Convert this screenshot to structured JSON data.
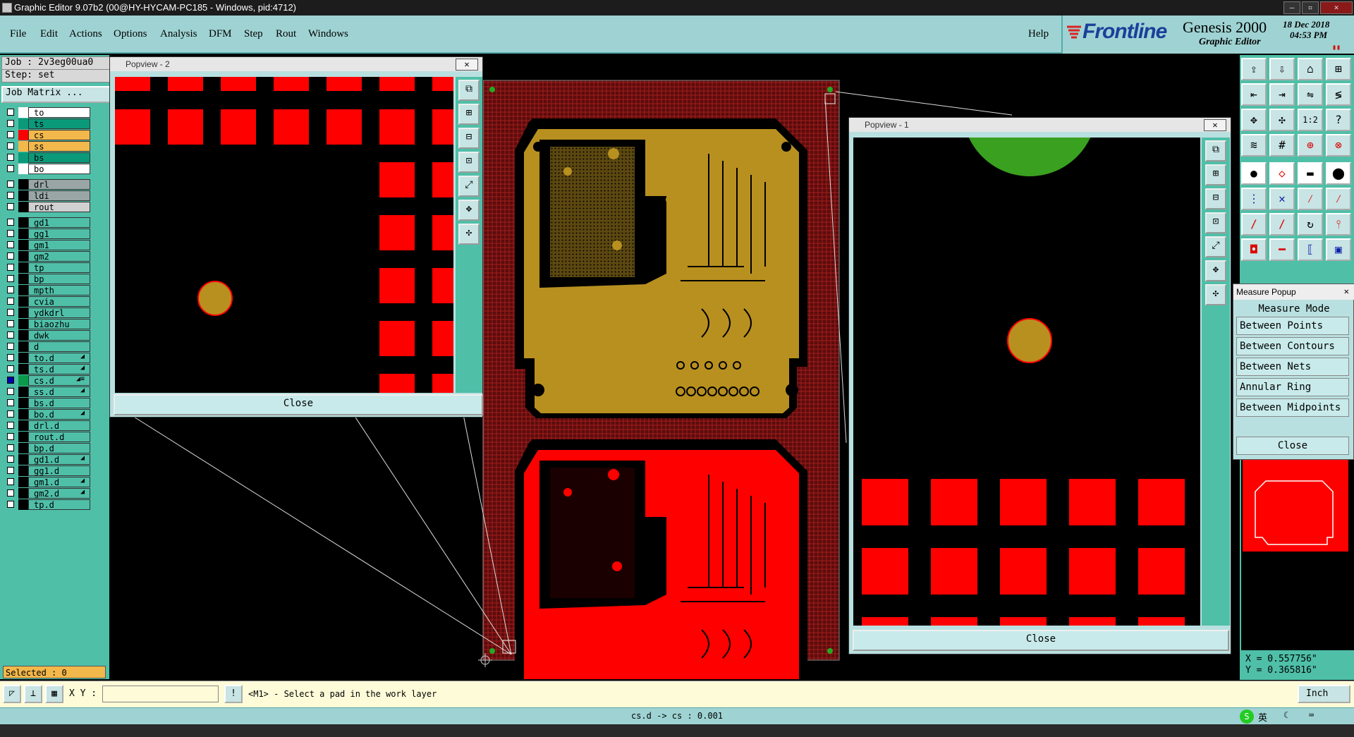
{
  "window": {
    "title": "Graphic Editor 9.07b2 (00@HY-HYCAM-PC185 - Windows, pid:4712)",
    "min_label": "–",
    "max_label": "▫",
    "close_label": "✕"
  },
  "menubar": {
    "items": [
      "File",
      "Edit",
      "Actions",
      "Options",
      "Analysis",
      "DFM",
      "Step",
      "Rout",
      "Windows"
    ],
    "help": "Help"
  },
  "brand": {
    "logo": "Frontline",
    "product": "Genesis 2000",
    "subtitle": "Graphic Editor",
    "date": "18 Dec 2018",
    "time": "04:53 PM"
  },
  "job": {
    "job": "Job : 2v3eg00ua0",
    "step": "Step: set",
    "matrix_button": "Job Matrix ..."
  },
  "layers": [
    {
      "name": "to",
      "color": "#ffffff",
      "bg": "#ffffff"
    },
    {
      "name": "ts",
      "color": "#0a9a7a",
      "bg": "#0a9a7a"
    },
    {
      "name": "cs",
      "color": "#ff0000",
      "bg": "#f2b84b",
      "active": true
    },
    {
      "name": "ss",
      "color": "#f2b84b",
      "bg": "#f2b84b"
    },
    {
      "name": "bs",
      "color": "#0a9a7a",
      "bg": "#0a9a7a"
    },
    {
      "name": "bo",
      "color": "#ffffff",
      "bg": "#ffffff"
    },
    {
      "name": "drl",
      "color": "#000000",
      "bg": "#9aa6a6",
      "gap": true
    },
    {
      "name": "ldi",
      "color": "#000000",
      "bg": "#9aa6a6"
    },
    {
      "name": "rout",
      "color": "#000000",
      "bg": "#d0d0d0"
    },
    {
      "name": "gd1",
      "color": "#000000",
      "bg": "#4fbfa8",
      "gap": true
    },
    {
      "name": "gg1",
      "color": "#000000",
      "bg": "#4fbfa8"
    },
    {
      "name": "gm1",
      "color": "#000000",
      "bg": "#4fbfa8"
    },
    {
      "name": "gm2",
      "color": "#000000",
      "bg": "#4fbfa8"
    },
    {
      "name": "tp",
      "color": "#000000",
      "bg": "#4fbfa8"
    },
    {
      "name": "bp",
      "color": "#000000",
      "bg": "#4fbfa8"
    },
    {
      "name": "mpth",
      "color": "#000000",
      "bg": "#4fbfa8"
    },
    {
      "name": "cvia",
      "color": "#000000",
      "bg": "#4fbfa8"
    },
    {
      "name": "ydkdrl",
      "color": "#000000",
      "bg": "#4fbfa8"
    },
    {
      "name": "biaozhu",
      "color": "#000000",
      "bg": "#4fbfa8"
    },
    {
      "name": "dwk",
      "color": "#000000",
      "bg": "#4fbfa8"
    },
    {
      "name": "d",
      "color": "#000000",
      "bg": "#4fbfa8"
    },
    {
      "name": "to.d",
      "color": "#000000",
      "bg": "#4fbfa8",
      "mark": "◢"
    },
    {
      "name": "ts.d",
      "color": "#000000",
      "bg": "#4fbfa8",
      "mark": "◢"
    },
    {
      "name": "cs.d",
      "color": "#0a9a4a",
      "bg": "#4fbfa8",
      "mark": "◢≡",
      "selected": true
    },
    {
      "name": "ss.d",
      "color": "#000000",
      "bg": "#4fbfa8",
      "mark": "◢"
    },
    {
      "name": "bs.d",
      "color": "#000000",
      "bg": "#4fbfa8"
    },
    {
      "name": "bo.d",
      "color": "#000000",
      "bg": "#4fbfa8",
      "mark": "◢"
    },
    {
      "name": "drl.d",
      "color": "#000000",
      "bg": "#4fbfa8"
    },
    {
      "name": "rout.d",
      "color": "#000000",
      "bg": "#4fbfa8"
    },
    {
      "name": "bp.d",
      "color": "#000000",
      "bg": "#4fbfa8"
    },
    {
      "name": "gd1.d",
      "color": "#000000",
      "bg": "#4fbfa8",
      "mark": "◢"
    },
    {
      "name": "gg1.d",
      "color": "#000000",
      "bg": "#4fbfa8"
    },
    {
      "name": "gm1.d",
      "color": "#000000",
      "bg": "#4fbfa8",
      "mark": "◢"
    },
    {
      "name": "gm2.d",
      "color": "#000000",
      "bg": "#4fbfa8",
      "mark": "◢"
    },
    {
      "name": "tp.d",
      "color": "#000000",
      "bg": "#4fbfa8"
    }
  ],
  "selected": "Selected : 0",
  "popview2": {
    "title": "Popview - 2",
    "close": "Close"
  },
  "popview1": {
    "title": "Popview - 1",
    "close": "Close"
  },
  "measure": {
    "title": "Measure Popup",
    "header": "Measure Mode",
    "modes": [
      "Between Points",
      "Between Contours",
      "Between Nets",
      "Annular Ring",
      "Between Midpoints"
    ],
    "close": "Close"
  },
  "coords": {
    "x": "X = 0.557756\"",
    "y": "Y = 0.365816\""
  },
  "command": {
    "xy_label": "X Y :",
    "xy_value": "",
    "prompt": "<M1> - Select a pad in the work layer",
    "units": "Inch"
  },
  "status": "cs.d -> cs : 0.001",
  "tray": {
    "ime": "英"
  },
  "colors": {
    "panel": "#4fbfa8",
    "menu": "#9fd3d3",
    "copper": "#b8901f",
    "red": "#ff0000",
    "board": "#6b1010"
  }
}
